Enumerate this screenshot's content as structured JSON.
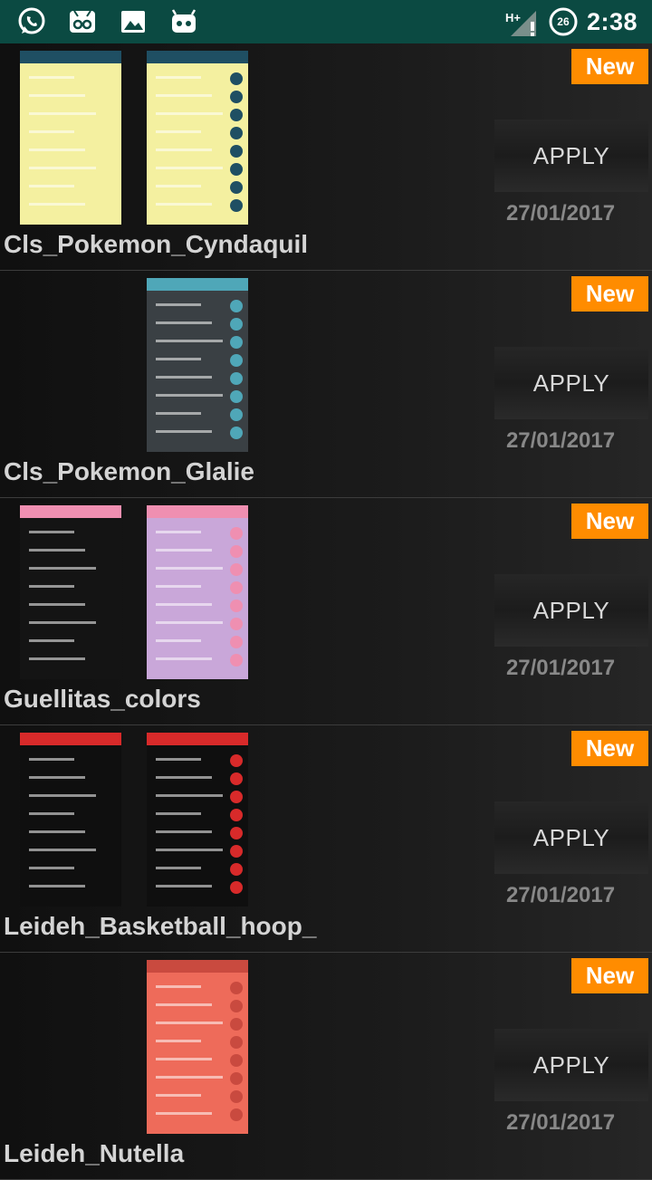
{
  "status_bar": {
    "network": "H+",
    "battery": "26",
    "time": "2:38",
    "icons": [
      "whatsapp-icon",
      "voicemail-icon",
      "image-icon",
      "android-icon"
    ]
  },
  "themes": [
    {
      "name": "Cls_Pokemon_Cyndaquil",
      "badge": "New",
      "apply_label": "APPLY",
      "date": "27/01/2017",
      "thumb_left_bg": "#f4f0a0",
      "thumb_right_bg": "#f4f0a0",
      "thumb_accent": "#1f4f63",
      "has_left_thumb": true
    },
    {
      "name": "Cls_Pokemon_Glalie",
      "badge": "New",
      "apply_label": "APPLY",
      "date": "27/01/2017",
      "thumb_left_bg": "",
      "thumb_right_bg": "#3a4044",
      "thumb_accent": "#4fa7b8",
      "has_left_thumb": false
    },
    {
      "name": "Guellitas_colors",
      "badge": "New",
      "apply_label": "APPLY",
      "date": "27/01/2017",
      "thumb_left_bg": "#141414",
      "thumb_right_bg": "#c9a7d9",
      "thumb_accent": "#ef8fb1",
      "has_left_thumb": true
    },
    {
      "name": "Leideh_Basketball_hoop_",
      "badge": "New",
      "apply_label": "APPLY",
      "date": "27/01/2017",
      "thumb_left_bg": "#0f0f0f",
      "thumb_right_bg": "#0f0f0f",
      "thumb_accent": "#d82a2a",
      "has_left_thumb": true
    },
    {
      "name": "Leideh_Nutella",
      "badge": "New",
      "apply_label": "APPLY",
      "date": "27/01/2017",
      "thumb_left_bg": "",
      "thumb_right_bg": "#ee6b5a",
      "thumb_accent": "#c94a3f",
      "has_left_thumb": false
    }
  ]
}
